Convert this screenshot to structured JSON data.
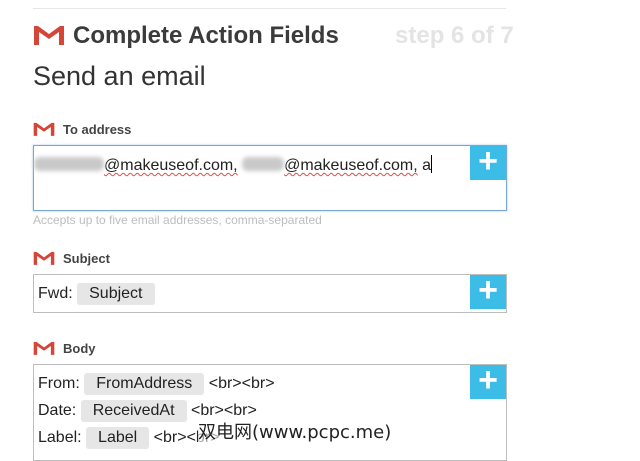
{
  "header": {
    "title": "Complete Action Fields",
    "step": "step 6 of 7"
  },
  "action_title": "Send an email",
  "fields": {
    "to": {
      "label": "To address",
      "value_part1": "@makeuseof.com,",
      "value_part2": "@makeuseof.com,",
      "value_part3": "a",
      "helper": "Accepts up to five email addresses, comma-separated"
    },
    "subject": {
      "label": "Subject",
      "prefix": "Fwd:",
      "token": "Subject"
    },
    "body": {
      "label": "Body",
      "lines": [
        {
          "key": "From:",
          "token": "FromAddress",
          "suffix": "<br><br>"
        },
        {
          "key": "Date:",
          "token": "ReceivedAt",
          "suffix": "<br><br>"
        },
        {
          "key": "Label:",
          "token": "Label",
          "suffix": "<br><br>"
        }
      ]
    }
  },
  "plus_symbol": "+",
  "icons": [
    "gmail-icon",
    "plus-icon"
  ],
  "colors": {
    "accent": "#3bbde8",
    "gmail_red": "#d44638",
    "step_text": "#e4e4e4"
  },
  "watermark": "双电网(www.pcpc.me)"
}
